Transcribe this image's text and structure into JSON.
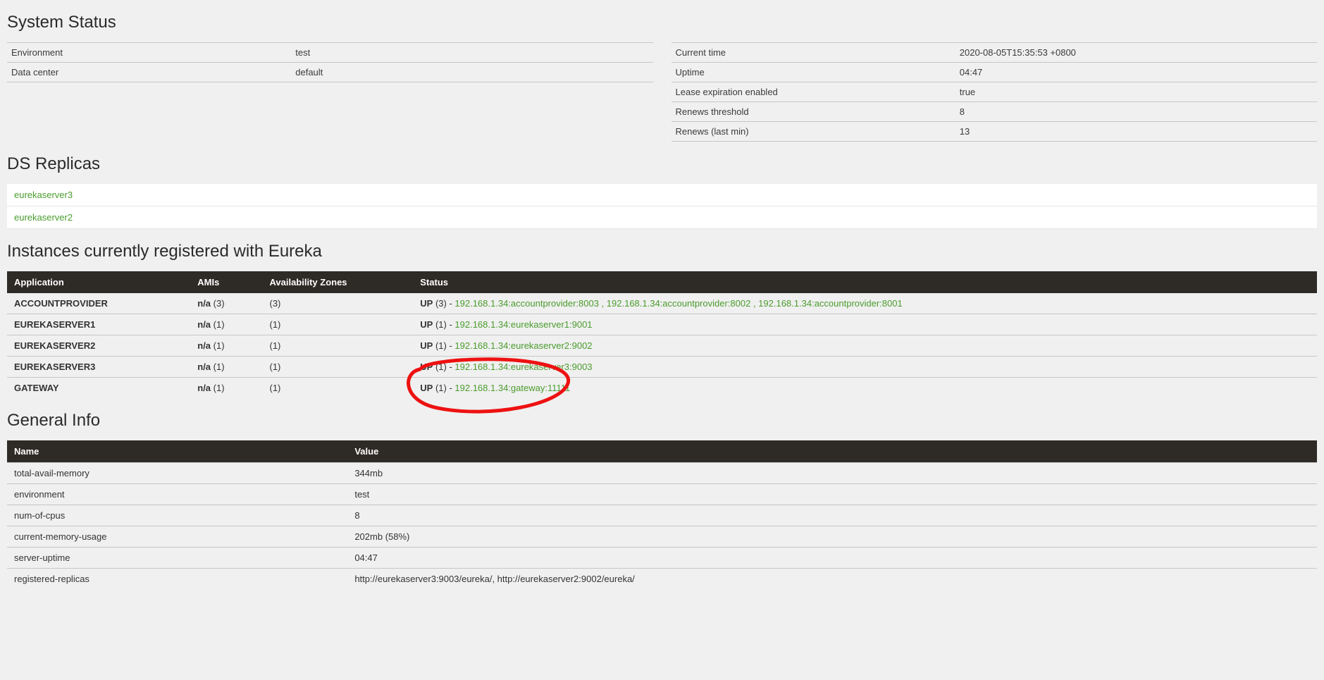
{
  "sections": {
    "system_status_title": "System Status",
    "ds_replicas_title": "DS Replicas",
    "instances_title": "Instances currently registered with Eureka",
    "general_info_title": "General Info"
  },
  "status_left": [
    {
      "key": "Environment",
      "value": "test"
    },
    {
      "key": "Data center",
      "value": "default"
    }
  ],
  "status_right": [
    {
      "key": "Current time",
      "value": "2020-08-05T15:35:53 +0800"
    },
    {
      "key": "Uptime",
      "value": "04:47"
    },
    {
      "key": "Lease expiration enabled",
      "value": "true"
    },
    {
      "key": "Renews threshold",
      "value": "8"
    },
    {
      "key": "Renews (last min)",
      "value": "13"
    }
  ],
  "replicas": [
    "eurekaserver3",
    "eurekaserver2"
  ],
  "instances_headers": {
    "application": "Application",
    "amis": "AMIs",
    "zones": "Availability Zones",
    "status": "Status"
  },
  "instances": [
    {
      "application": "ACCOUNTPROVIDER",
      "amis_label": "n/a",
      "amis_count": "(3)",
      "zones": "(3)",
      "status_label": "UP",
      "status_count": "(3)",
      "links": [
        "192.168.1.34:accountprovider:8003",
        "192.168.1.34:accountprovider:8002",
        "192.168.1.34:accountprovider:8001"
      ]
    },
    {
      "application": "EUREKASERVER1",
      "amis_label": "n/a",
      "amis_count": "(1)",
      "zones": "(1)",
      "status_label": "UP",
      "status_count": "(1)",
      "links": [
        "192.168.1.34:eurekaserver1:9001"
      ]
    },
    {
      "application": "EUREKASERVER2",
      "amis_label": "n/a",
      "amis_count": "(1)",
      "zones": "(1)",
      "status_label": "UP",
      "status_count": "(1)",
      "links": [
        "192.168.1.34:eurekaserver2:9002"
      ]
    },
    {
      "application": "EUREKASERVER3",
      "amis_label": "n/a",
      "amis_count": "(1)",
      "zones": "(1)",
      "status_label": "UP",
      "status_count": "(1)",
      "links": [
        "192.168.1.34:eurekaserver3:9003"
      ]
    },
    {
      "application": "GATEWAY",
      "amis_label": "n/a",
      "amis_count": "(1)",
      "zones": "(1)",
      "status_label": "UP",
      "status_count": "(1)",
      "links": [
        "192.168.1.34:gateway:11111"
      ]
    }
  ],
  "general_headers": {
    "name": "Name",
    "value": "Value"
  },
  "general_info": [
    {
      "name": "total-avail-memory",
      "value": "344mb"
    },
    {
      "name": "environment",
      "value": "test"
    },
    {
      "name": "num-of-cpus",
      "value": "8"
    },
    {
      "name": "current-memory-usage",
      "value": "202mb (58%)"
    },
    {
      "name": "server-uptime",
      "value": "04:47"
    },
    {
      "name": "registered-replicas",
      "value": "http://eurekaserver3:9003/eureka/, http://eurekaserver2:9002/eureka/"
    }
  ],
  "col_widths": {
    "application": "14%",
    "amis": "5.5%",
    "zones": "11.5%"
  }
}
